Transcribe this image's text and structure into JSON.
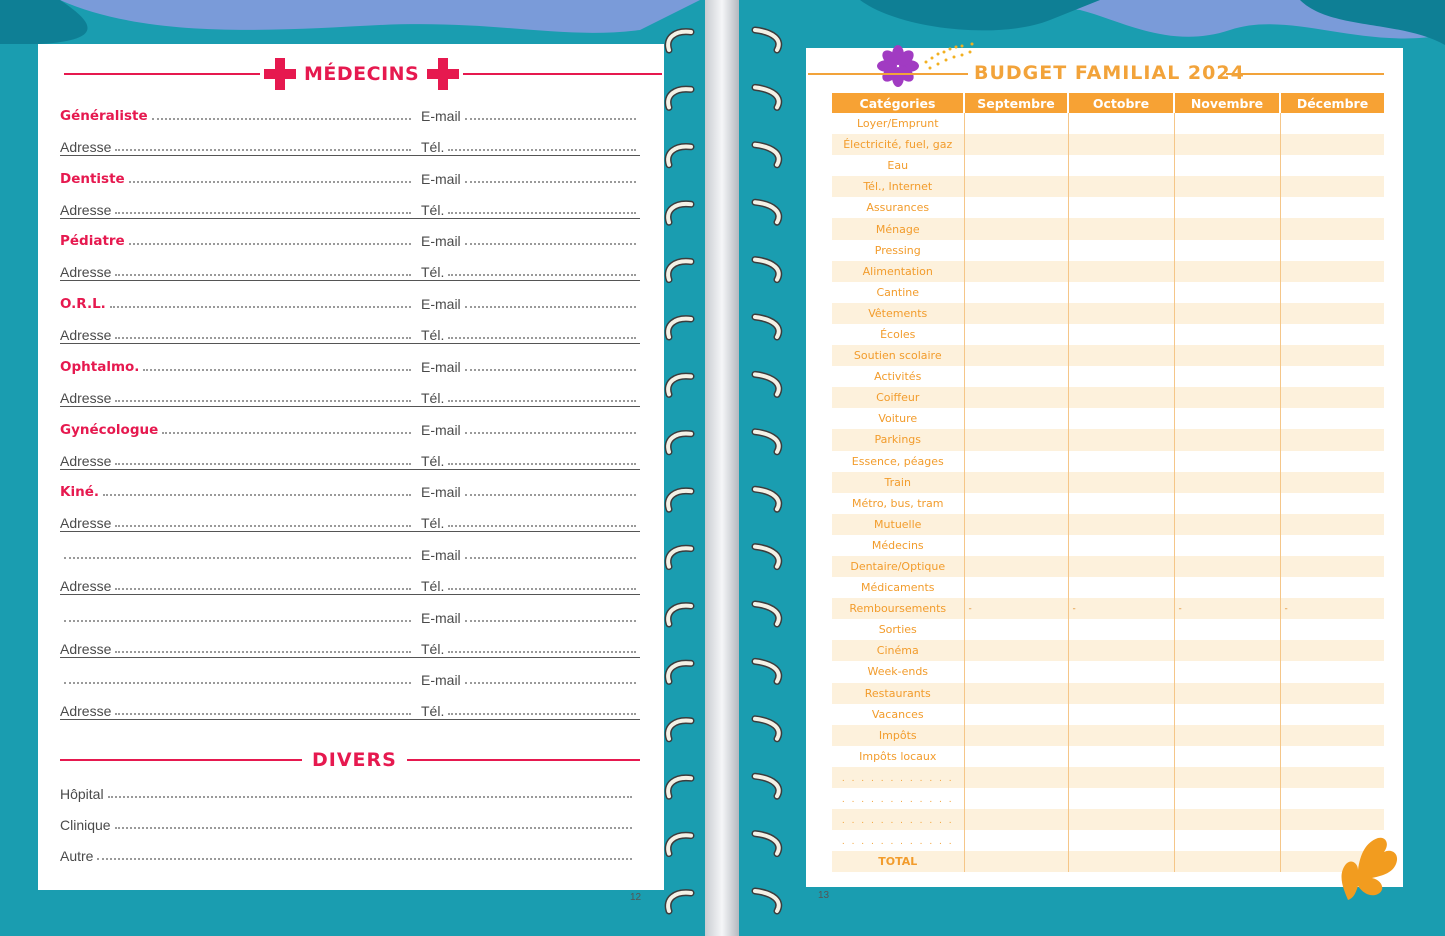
{
  "left_page": {
    "heading": "MÉDECINS",
    "page_number": "12",
    "entries": [
      {
        "name": "Généraliste",
        "email_label": "E-mail",
        "address_label": "Adresse",
        "tel_label": "Tél."
      },
      {
        "name": "Dentiste",
        "email_label": "E-mail",
        "address_label": "Adresse",
        "tel_label": "Tél."
      },
      {
        "name": "Pédiatre",
        "email_label": "E-mail",
        "address_label": "Adresse",
        "tel_label": "Tél."
      },
      {
        "name": "O.R.L.",
        "email_label": "E-mail",
        "address_label": "Adresse",
        "tel_label": "Tél."
      },
      {
        "name": "Ophtalmo.",
        "email_label": "E-mail",
        "address_label": "Adresse",
        "tel_label": "Tél."
      },
      {
        "name": "Gynécologue",
        "email_label": "E-mail",
        "address_label": "Adresse",
        "tel_label": "Tél."
      },
      {
        "name": "Kiné.",
        "email_label": "E-mail",
        "address_label": "Adresse",
        "tel_label": "Tél."
      },
      {
        "name": "",
        "email_label": "E-mail",
        "address_label": "Adresse",
        "tel_label": "Tél."
      },
      {
        "name": "",
        "email_label": "E-mail",
        "address_label": "Adresse",
        "tel_label": "Tél."
      },
      {
        "name": "",
        "email_label": "E-mail",
        "address_label": "Adresse",
        "tel_label": "Tél."
      }
    ],
    "divers_heading": "DIVERS",
    "divers_items": [
      "Hôpital",
      "Clinique",
      "Autre"
    ]
  },
  "right_page": {
    "title": "BUDGET FAMILIAL 2024",
    "page_number": "13",
    "columns": [
      "Catégories",
      "Septembre",
      "Octobre",
      "Novembre",
      "Décembre"
    ],
    "categories": [
      "Loyer/Emprunt",
      "Électricité, fuel, gaz",
      "Eau",
      "Tél., Internet",
      "Assurances",
      "Ménage",
      "Pressing",
      "Alimentation",
      "Cantine",
      "Vêtements",
      "Écoles",
      "Soutien scolaire",
      "Activités",
      "Coiffeur",
      "Voiture",
      "Parkings",
      "Essence, péages",
      "Train",
      "Métro, bus, tram",
      "Mutuelle",
      "Médecins",
      "Dentaire/Optique",
      "Médicaments",
      "Remboursements",
      "Sorties",
      "Cinéma",
      "Week-ends",
      "Restaurants",
      "Vacances",
      "Impôts",
      "Impôts locaux"
    ],
    "blank_rows": 4,
    "dash_row": "Remboursements",
    "dash_symbol": "-",
    "total_label": "TOTAL"
  },
  "colors": {
    "background": "#1a9db0",
    "pink_accent": "#e6194f",
    "orange_accent": "#f7a234",
    "row_tint": "#fdf1dc"
  }
}
